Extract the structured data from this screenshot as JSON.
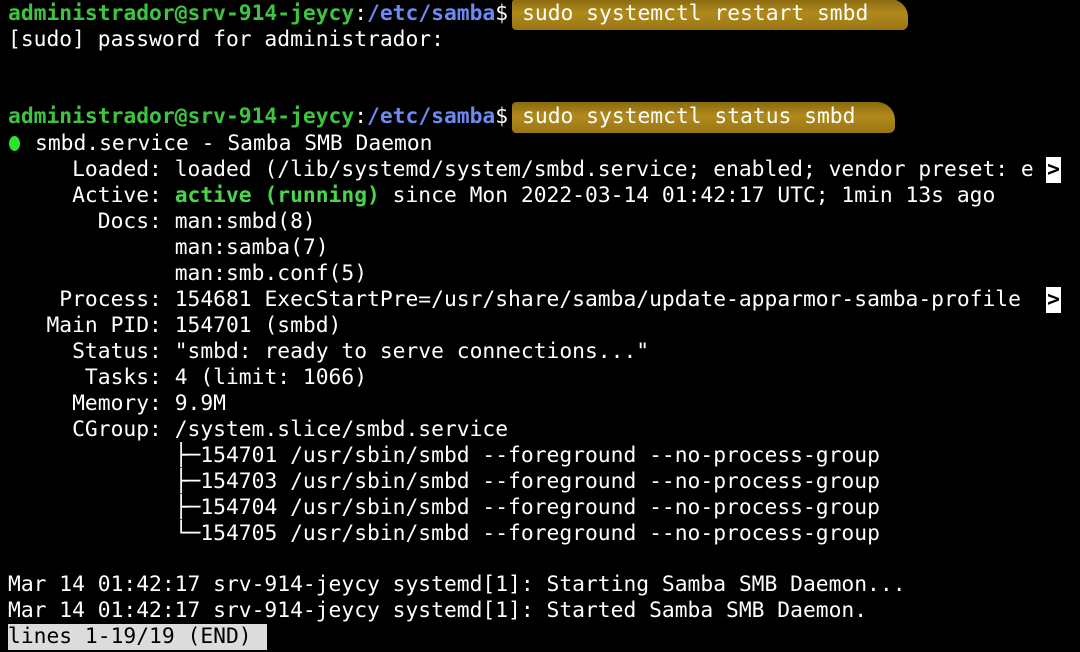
{
  "prompt1": {
    "user": "administrador@srv-914-jeycy",
    "sep": ":",
    "path": "/etc/samba",
    "symbol": "$",
    "command": "sudo systemctl restart smbd"
  },
  "sudo_line": "[sudo] password for administrador:",
  "prompt2": {
    "user": "administrador@srv-914-jeycy",
    "sep": ":",
    "path": "/etc/samba",
    "symbol": "$",
    "command": "sudo systemctl status smbd"
  },
  "service_header": "smbd.service - Samba SMB Daemon",
  "status": {
    "loaded_key": "     Loaded: ",
    "loaded_val": "loaded (/lib/systemd/system/smbd.service; enabled; vendor preset: e",
    "active_key": "     Active: ",
    "active_state": "active (running)",
    "active_rest": " since Mon 2022-03-14 01:42:17 UTC; 1min 13s ago",
    "docs_key": "       Docs: ",
    "docs": [
      "man:smbd(8)",
      "man:samba(7)",
      "man:smb.conf(5)"
    ],
    "process_key": "    Process: ",
    "process_val": "154681 ExecStartPre=/usr/share/samba/update-apparmor-samba-profile ",
    "mainpid_key": "   Main PID: ",
    "mainpid_val": "154701 (smbd)",
    "statusline_key": "     Status: ",
    "statusline_val": "\"smbd: ready to serve connections...\"",
    "tasks_key": "      Tasks: ",
    "tasks_val": "4 (limit: 1066)",
    "memory_key": "     Memory: ",
    "memory_val": "9.9M",
    "cgroup_key": "     CGroup: ",
    "cgroup_val": "/system.slice/smbd.service",
    "cgroup_children": [
      "├─154701 /usr/sbin/smbd --foreground --no-process-group",
      "├─154703 /usr/sbin/smbd --foreground --no-process-group",
      "├─154704 /usr/sbin/smbd --foreground --no-process-group",
      "└─154705 /usr/sbin/smbd --foreground --no-process-group"
    ]
  },
  "journal": [
    "Mar 14 01:42:17 srv-914-jeycy systemd[1]: Starting Samba SMB Daemon...",
    "Mar 14 01:42:17 srv-914-jeycy systemd[1]: Started Samba SMB Daemon."
  ],
  "truncation_marker": ">",
  "pager_status": "lines 1-19/19 (END)",
  "colors": {
    "background": "#000000",
    "prompt_user": "#3ec43e",
    "prompt_path": "#6b8bf0",
    "active_green": "#4cd44c",
    "highlight": "#a07c16"
  }
}
